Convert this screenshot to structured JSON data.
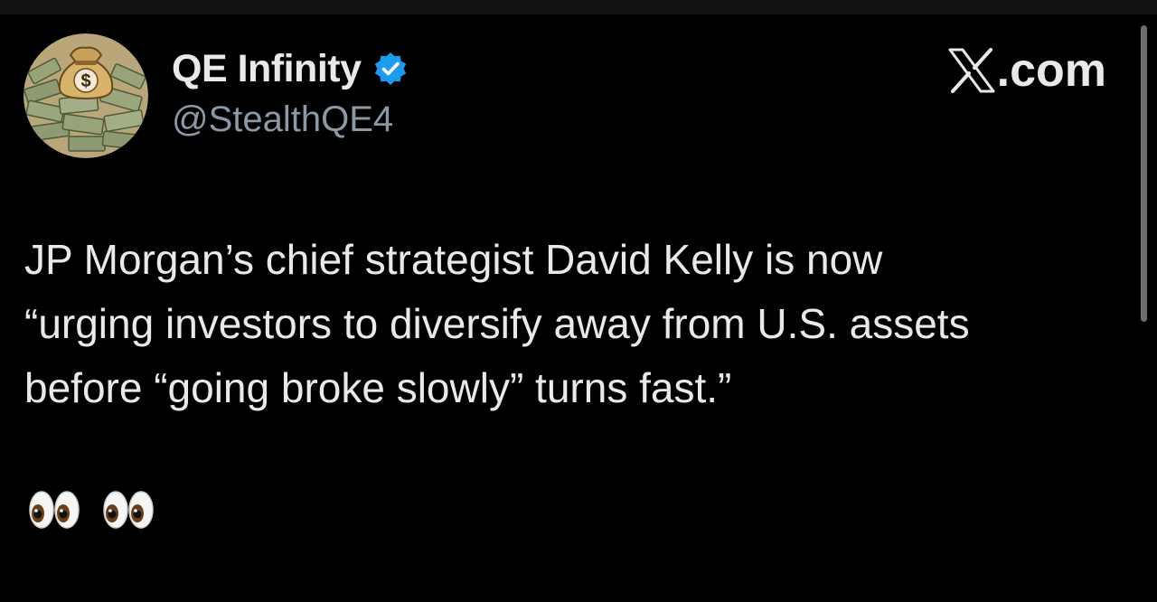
{
  "account": {
    "display_name": "QE Infinity",
    "handle": "@StealthQE4",
    "verified": true,
    "verified_badge_color": "#1d9bf0"
  },
  "brand": {
    "text": ".com",
    "logo": "x-logo-icon"
  },
  "post": {
    "lines": [
      "JP Morgan’s chief strategist David Kelly is now",
      "“urging investors to diversify away from U.S. assets",
      "before “going broke slowly” turns fast.”"
    ],
    "emojis": [
      "eyes-emoji",
      "eyes-emoji"
    ]
  },
  "colors": {
    "background": "#000000",
    "primary_text": "#e7e9ea",
    "secondary_text": "#8b98a5"
  }
}
